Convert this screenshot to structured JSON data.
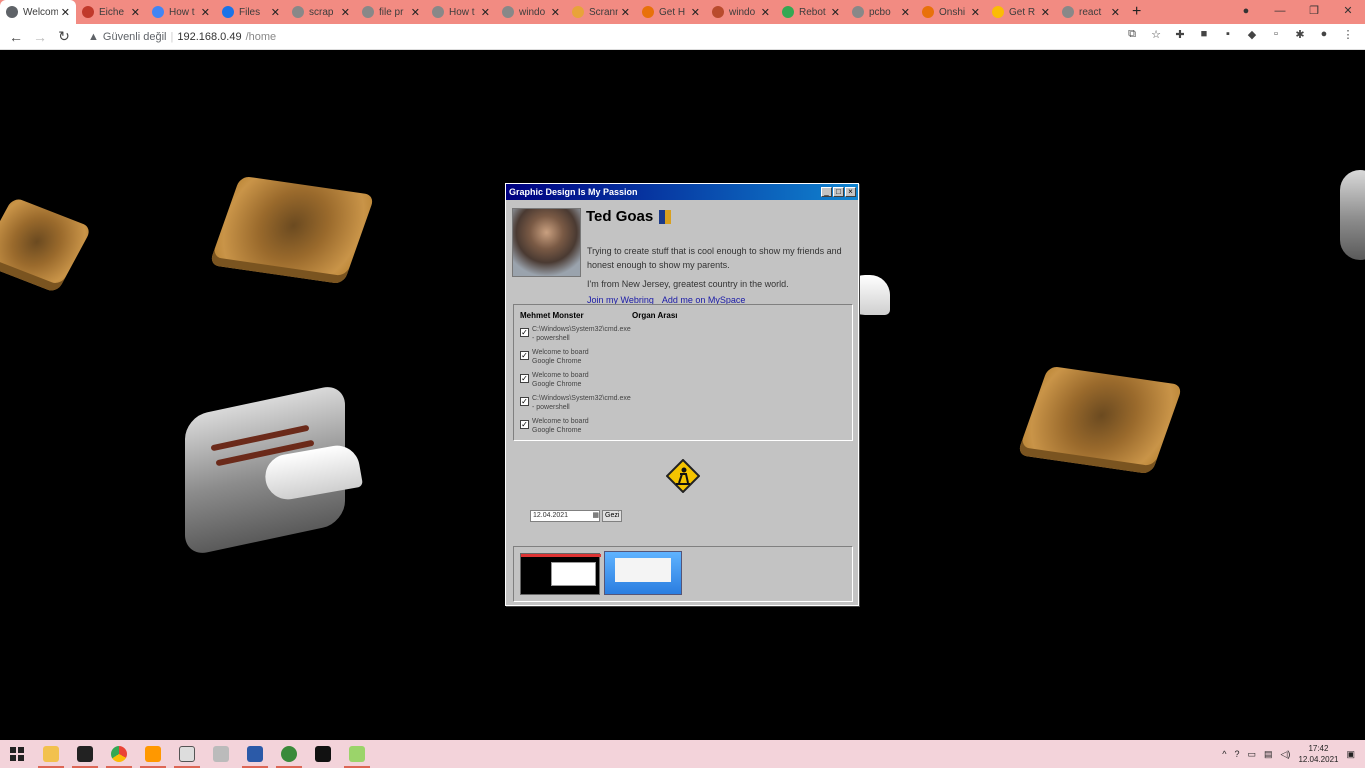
{
  "browser": {
    "tabs": [
      {
        "title": "Welcom",
        "active": true,
        "color": "#5f6368"
      },
      {
        "title": "Eiche",
        "active": false,
        "color": "#c0392b"
      },
      {
        "title": "How t",
        "active": false,
        "color": "#4285f4"
      },
      {
        "title": "Files",
        "active": false,
        "color": "#1a73e8"
      },
      {
        "title": "scrap",
        "active": false,
        "color": "#888888"
      },
      {
        "title": "file pr",
        "active": false,
        "color": "#888888"
      },
      {
        "title": "How t",
        "active": false,
        "color": "#888888"
      },
      {
        "title": "windo",
        "active": false,
        "color": "#888888"
      },
      {
        "title": "Scrann",
        "active": false,
        "color": "#e8a33a"
      },
      {
        "title": "Get H",
        "active": false,
        "color": "#e8710a"
      },
      {
        "title": "windo",
        "active": false,
        "color": "#b94b2d"
      },
      {
        "title": "Rebot",
        "active": false,
        "color": "#34a853"
      },
      {
        "title": "pcbo",
        "active": false,
        "color": "#888888"
      },
      {
        "title": "Onshi",
        "active": false,
        "color": "#e8710a"
      },
      {
        "title": "Get R",
        "active": false,
        "color": "#fbbc05"
      },
      {
        "title": "react",
        "active": false,
        "color": "#888888"
      }
    ],
    "security": "Güvenli değil",
    "host": "192.168.0.49",
    "path": "/home"
  },
  "window": {
    "title": "Graphic Design Is My Passion",
    "profile": {
      "name": "Ted Goas",
      "bio": "Trying to create stuff that is cool enough to show my friends and honest enough to show my parents.",
      "location": "I'm from New Jersey, greatest country in the world.",
      "link_webring": "Join my Webring",
      "link_myspace": "Add me on MySpace"
    },
    "columns": {
      "left": "Mehmet Monster",
      "right": "Organ Arası"
    },
    "items": [
      {
        "line1": "C:\\Windows\\System32\\cmd.exe",
        "line2": "- powershell"
      },
      {
        "line1": "Welcome to board",
        "line2": "Google Chrome"
      },
      {
        "line1": "Welcome to board",
        "line2": "Google Chrome"
      },
      {
        "line1": "C:\\Windows\\System32\\cmd.exe",
        "line2": "- powershell"
      },
      {
        "line1": "Welcome to board",
        "line2": "Google Chrome"
      }
    ],
    "date_value": "12.04.2021",
    "date_button": "Gezi"
  },
  "taskbar": {
    "time": "17:42",
    "date": "12.04.2021"
  }
}
